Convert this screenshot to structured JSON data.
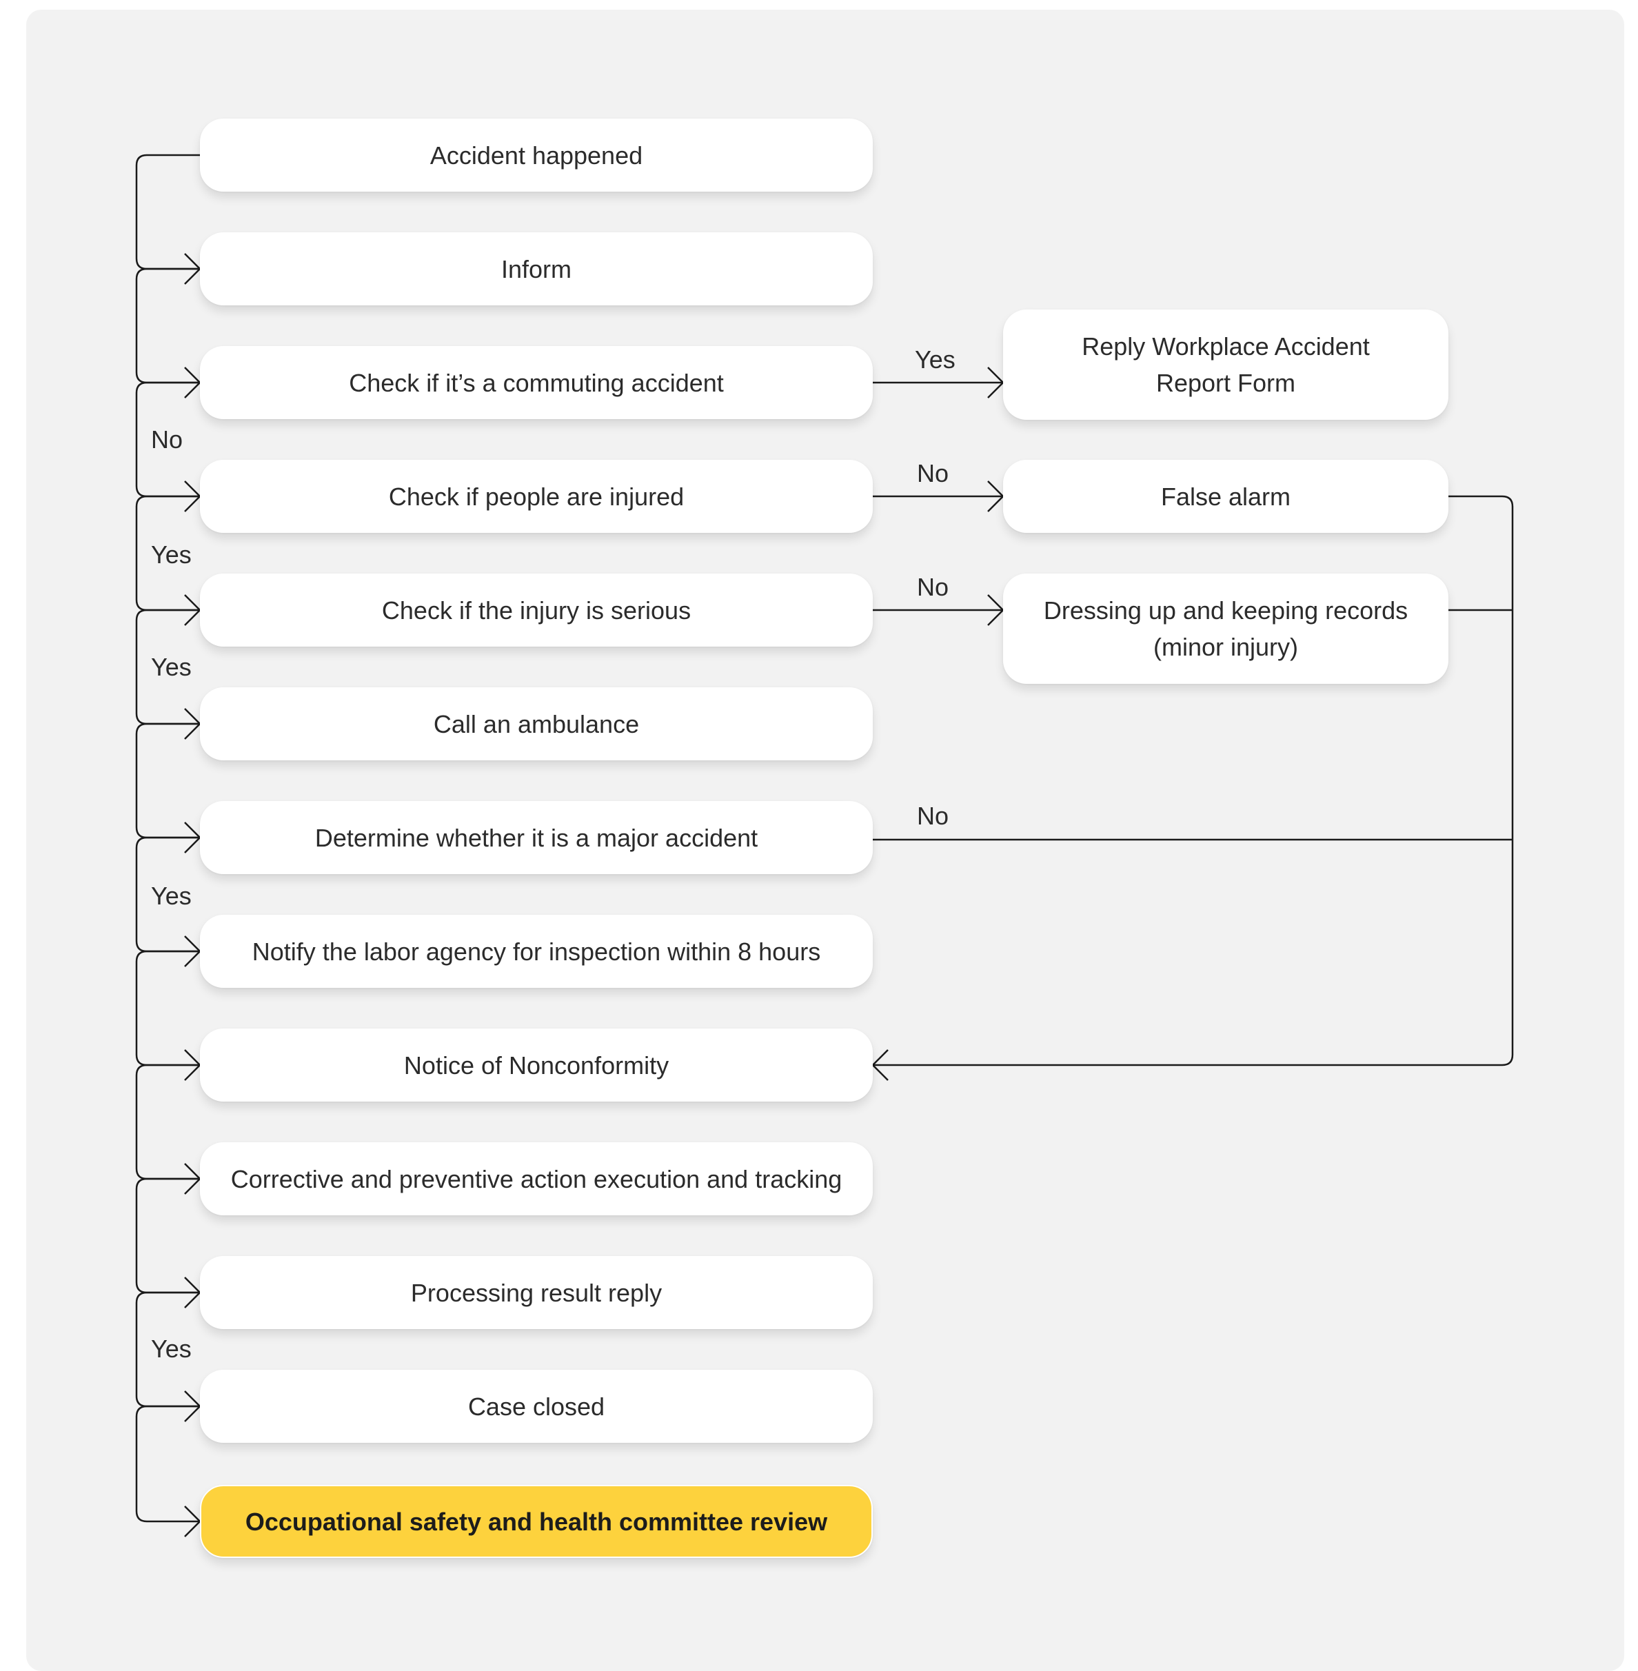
{
  "nodes": {
    "accident_happened": "Accident happened",
    "inform": "Inform",
    "check_commuting": "Check if it’s a commuting accident",
    "check_injured": "Check if people are injured",
    "check_serious": "Check if the injury is serious",
    "call_ambulance": "Call an ambulance",
    "determine_major": "Determine whether it is a major accident",
    "notify_labor": "Notify the labor agency for inspection within 8 hours",
    "notice_nonconformity": "Notice of Nonconformity",
    "corrective_action": "Corrective and preventive action execution and tracking",
    "processing_result": "Processing result reply",
    "case_closed": "Case closed",
    "committee_review": "Occupational safety and health committee review",
    "reply_form_line1": "Reply Workplace Accident",
    "reply_form_line2": "Report Form",
    "false_alarm": "False alarm",
    "dressing_line1": "Dressing up and keeping records",
    "dressing_line2": "(minor injury)"
  },
  "labels": {
    "commuting_no": "No",
    "injured_yes": "Yes",
    "serious_yes": "Yes",
    "major_yes": "Yes",
    "closed_yes": "Yes",
    "commuting_yes": "Yes",
    "injured_no": "No",
    "serious_no": "No",
    "major_no": "No"
  },
  "colors": {
    "panel": "#f2f2f2",
    "box": "#ffffff",
    "final_box": "#fdd23d",
    "line": "#1a1a1a"
  }
}
